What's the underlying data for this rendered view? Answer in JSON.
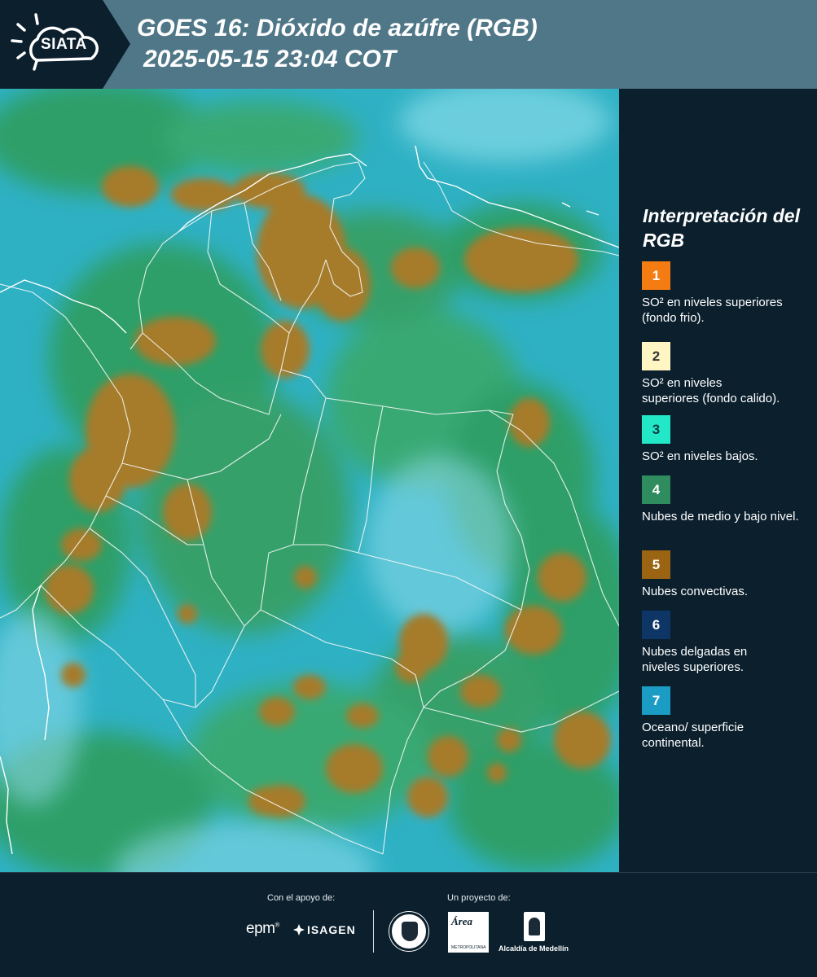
{
  "header": {
    "logo_text": "SIATA",
    "title_line1": "GOES 16: Dióxido de azúfre (RGB)",
    "title_line2": "2025-05-15 23:04 COT"
  },
  "legend": {
    "title": "Interpretación del RGB",
    "items": [
      {
        "number": "1",
        "label": "SO² en niveles superiores (fondo frio).",
        "color": "#f57c12"
      },
      {
        "number": "2",
        "label": "SO² en niveles superiores (fondo calido).",
        "color": "#fff6c4"
      },
      {
        "number": "3",
        "label": "SO² en niveles bajos.",
        "color": "#22e8c8"
      },
      {
        "number": "4",
        "label": "Nubes de medio y bajo nivel.",
        "color": "#2e8c5e"
      },
      {
        "number": "5",
        "label": "Nubes convectivas.",
        "color": "#9a6412"
      },
      {
        "number": "6",
        "label": "Nubes delgadas en niveles superiores.",
        "color": "#0d3666"
      },
      {
        "number": "7",
        "label": "Oceano/ superficie continental.",
        "color": "#1b9cc4"
      }
    ]
  },
  "footer": {
    "support_label": "Con el apoyo de:",
    "project_label": "Un proyecto de:",
    "epm": "epm",
    "isagen": "ISAGEN",
    "area_logo": "Área",
    "area_subtitle": "METROPOLITANA Valle de Aburrá",
    "alcaldia": "Alcaldía de Medellín"
  },
  "colors": {
    "header_bg": "#4f7787",
    "panel_bg": "#0b1f2d",
    "convective_cloud": "#a67c2c",
    "midlevel_cloud": "#2f9c58",
    "surface": "#2fb1c4"
  }
}
